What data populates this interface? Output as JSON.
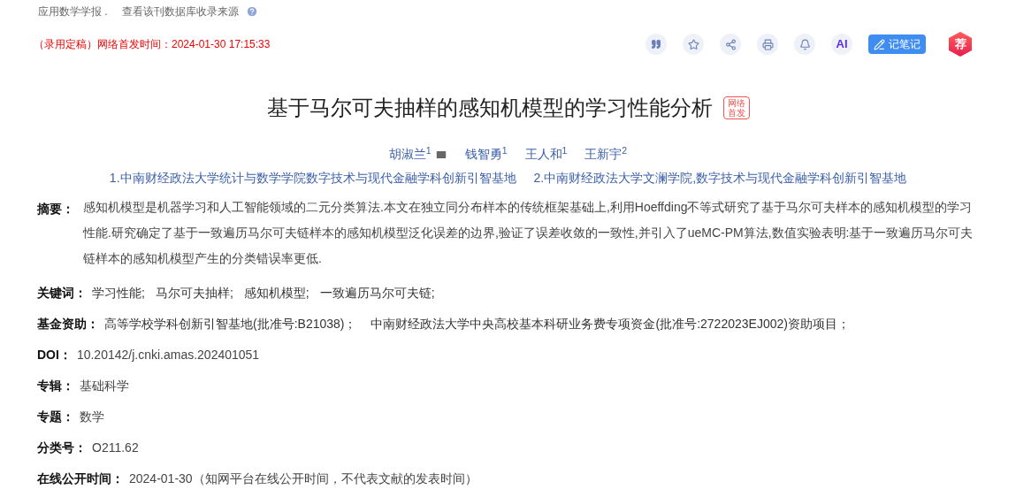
{
  "top_bar": {
    "journal": "应用数学学报 .",
    "source_link": "查看该刊数据库收录来源"
  },
  "status": {
    "tag": "（录用定稿）",
    "label": "网络首发时间：",
    "time": "2024-01-30 17:15:33"
  },
  "toolbar": [
    {
      "kind": "quote"
    },
    {
      "kind": "star"
    },
    {
      "kind": "share"
    },
    {
      "kind": "print"
    },
    {
      "kind": "bell"
    },
    {
      "kind": "ai",
      "label": "AI"
    },
    {
      "kind": "note",
      "label": "记笔记"
    },
    {
      "kind": "recommend",
      "label": "荐"
    }
  ],
  "title": "基于马尔可夫抽样的感知机模型的学习性能分析",
  "title_badge": "网络首发",
  "authors": [
    {
      "name": "胡淑兰",
      "sup": "1",
      "email": true
    },
    {
      "name": "钱智勇",
      "sup": "1",
      "email": false
    },
    {
      "name": "王人和",
      "sup": "1",
      "email": false
    },
    {
      "name": "王新宇",
      "sup": "2",
      "email": false
    }
  ],
  "affiliations": [
    "1.中南财经政法大学统计与数学学院数字技术与现代金融学科创新引智基地",
    "2.中南财经政法大学文澜学院,数字技术与现代金融学科创新引智基地"
  ],
  "abstract": {
    "label": "摘要：",
    "text": "感知机模型是机器学习和人工智能领域的二元分类算法.本文在独立同分布样本的传统框架基础上,利用Hoeffding不等式研究了基于马尔可夫样本的感知机模型的学习性能.研究确定了基于一致遍历马尔可夫链样本的感知机模型泛化误差的边界,验证了误差收敛的一致性,并引入了ueMC-PM算法,数值实验表明:基于一致遍历马尔可夫链样本的感知机模型产生的分类错误率更低."
  },
  "keywords": {
    "label": "关键词：",
    "items": [
      "学习性能;",
      "马尔可夫抽样;",
      "感知机模型;",
      "一致遍历马尔可夫链;"
    ]
  },
  "funds": {
    "label": "基金资助：",
    "items": [
      "高等学校学科创新引智基地(批准号:B21038)；",
      "中南财经政法大学中央高校基本科研业务费专项资金(批准号:2722023EJ002)资助项目；"
    ]
  },
  "fields": [
    {
      "label": "DOI：",
      "value": "10.20142/j.cnki.amas.202401051"
    },
    {
      "label": "专辑：",
      "value": "基础科学"
    },
    {
      "label": "专题：",
      "value": "数学"
    },
    {
      "label": "分类号：",
      "value": "O211.62"
    },
    {
      "label": "在线公开时间：",
      "value": "2024-01-30（知网平台在线公开时间，不代表文献的发表时间）"
    }
  ]
}
